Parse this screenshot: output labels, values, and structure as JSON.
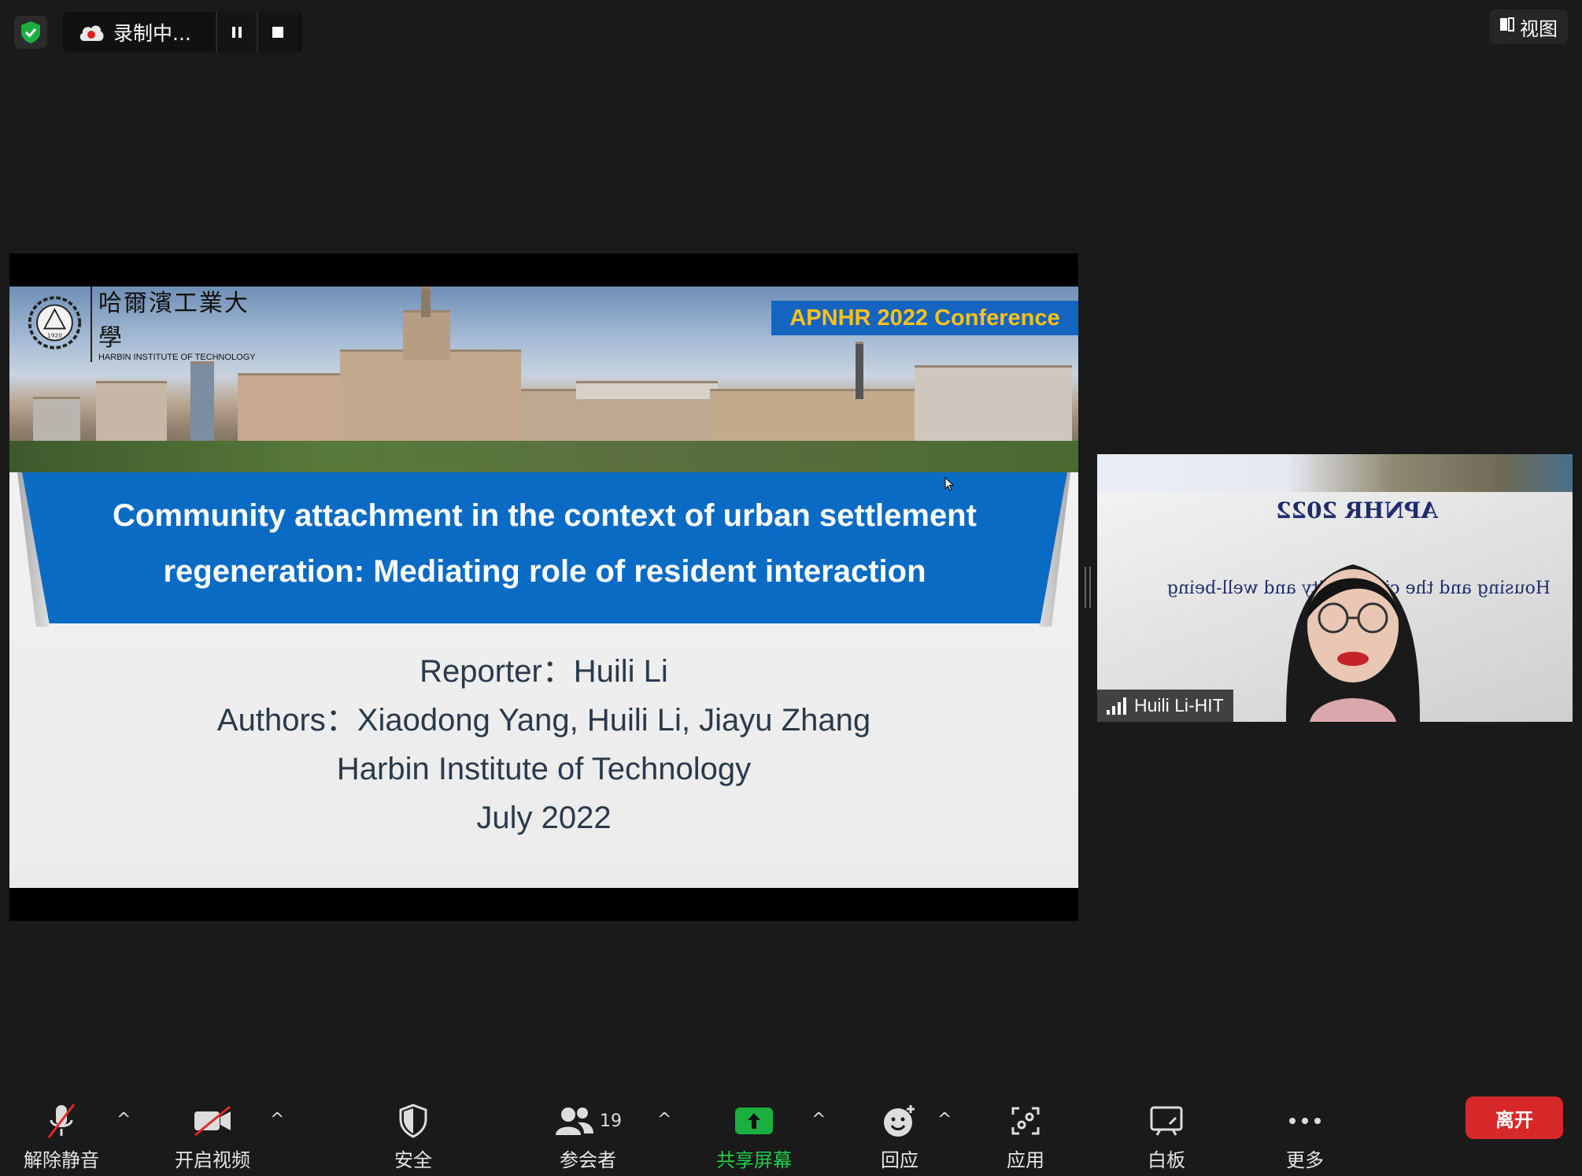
{
  "topbar": {
    "recording_label": "录制中...",
    "view_label": "视图"
  },
  "slide": {
    "university_zh": "哈爾濱工業大學",
    "university_en": "HARBIN INSTITUTE OF TECHNOLOGY",
    "seal_year": "1920",
    "conference_tag": "APNHR 2022 Conference",
    "title_line1": "Community attachment in the context of urban settlement",
    "title_line2": "regeneration: Mediating role of resident interaction",
    "reporter": "Reporter：Huili Li",
    "authors": "Authors：Xiaodong Yang, Huili Li, Jiayu Zhang",
    "institution": "Harbin Institute of Technology",
    "date": "July 2022"
  },
  "video": {
    "participant_name": "Huili Li-HIT",
    "background_title": "APNHR 2022",
    "background_subtitle": "Housing and the city: equity and well-being"
  },
  "toolbar": {
    "unmute": "解除静音",
    "start_video": "开启视频",
    "security": "安全",
    "participants": "参会者",
    "participant_count": "19",
    "share_screen": "共享屏幕",
    "reactions": "回应",
    "apps": "应用",
    "whiteboard": "白板",
    "more": "更多",
    "leave": "离开"
  },
  "colors": {
    "share_green": "#1aaf3f",
    "leave_red": "#d62828",
    "slide_blue": "#0a6bc4",
    "conference_yellow": "#ffc21a"
  }
}
